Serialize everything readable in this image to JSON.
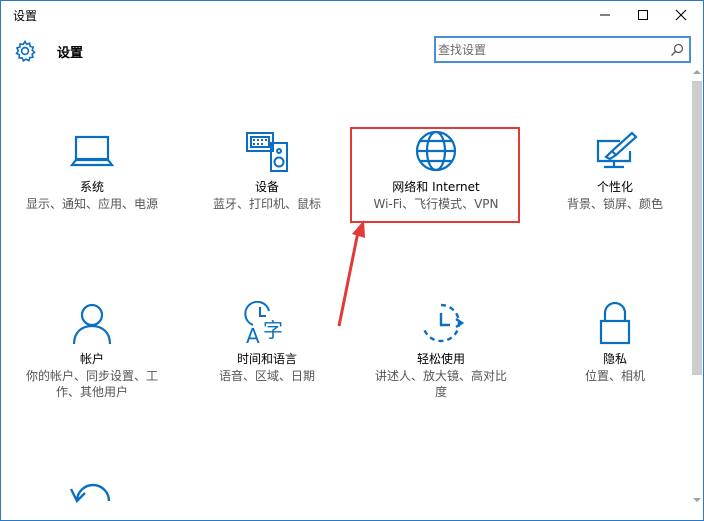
{
  "window": {
    "title": "设置",
    "minimize_glyph": "–",
    "maximize_glyph": "☐",
    "close_glyph": "✕"
  },
  "header": {
    "title": "设置",
    "icon": "gear-icon"
  },
  "search": {
    "placeholder": "查找设置",
    "value": "",
    "icon": "search-icon"
  },
  "tiles": [
    {
      "id": "system",
      "icon": "laptop-icon",
      "name": "系统",
      "desc": "显示、通知、应用、电源"
    },
    {
      "id": "devices",
      "icon": "devices-icon",
      "name": "设备",
      "desc": "蓝牙、打印机、鼠标"
    },
    {
      "id": "network",
      "icon": "globe-icon",
      "name": "网络和 Internet",
      "desc": "Wi-Fi、飞行模式、VPN"
    },
    {
      "id": "personalization",
      "icon": "paint-screen-icon",
      "name": "个性化",
      "desc": "背景、锁屏、颜色"
    },
    {
      "id": "accounts",
      "icon": "person-icon",
      "name": "帐户",
      "desc": "你的帐户、同步设置、工作、其他用户"
    },
    {
      "id": "time-language",
      "icon": "clock-language-icon",
      "name": "时间和语言",
      "desc": "语音、区域、日期"
    },
    {
      "id": "ease-of-access",
      "icon": "ease-of-access-icon",
      "name": "轻松使用",
      "desc": "讲述人、放大镜、高对比度"
    },
    {
      "id": "privacy",
      "icon": "lock-icon",
      "name": "隐私",
      "desc": "位置、相机"
    },
    {
      "id": "update",
      "icon": "update-icon",
      "name": "",
      "desc": ""
    }
  ],
  "colors": {
    "accent": "#0a6fc2",
    "highlight": "#e23a3a"
  }
}
